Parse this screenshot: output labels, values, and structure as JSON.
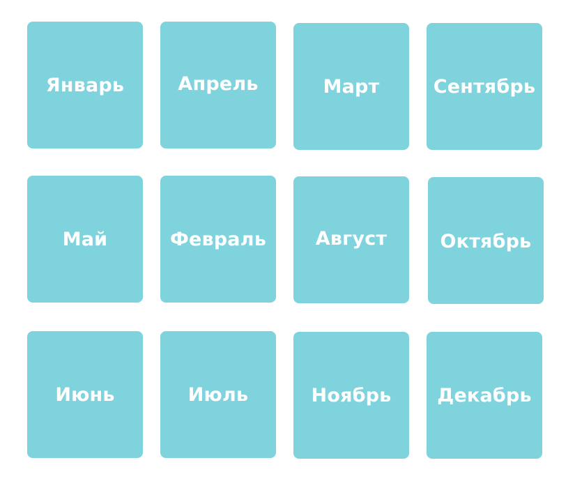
{
  "card_color": "#7fd3dd",
  "label_color": "#ffffff",
  "cards": [
    {
      "label": "Январь"
    },
    {
      "label": "Апрель"
    },
    {
      "label": "Март"
    },
    {
      "label": "Сентябрь"
    },
    {
      "label": "Май"
    },
    {
      "label": "Февраль"
    },
    {
      "label": "Август"
    },
    {
      "label": "Октябрь"
    },
    {
      "label": "Июнь"
    },
    {
      "label": "Июль"
    },
    {
      "label": "Ноябрь"
    },
    {
      "label": "Декабрь"
    }
  ]
}
